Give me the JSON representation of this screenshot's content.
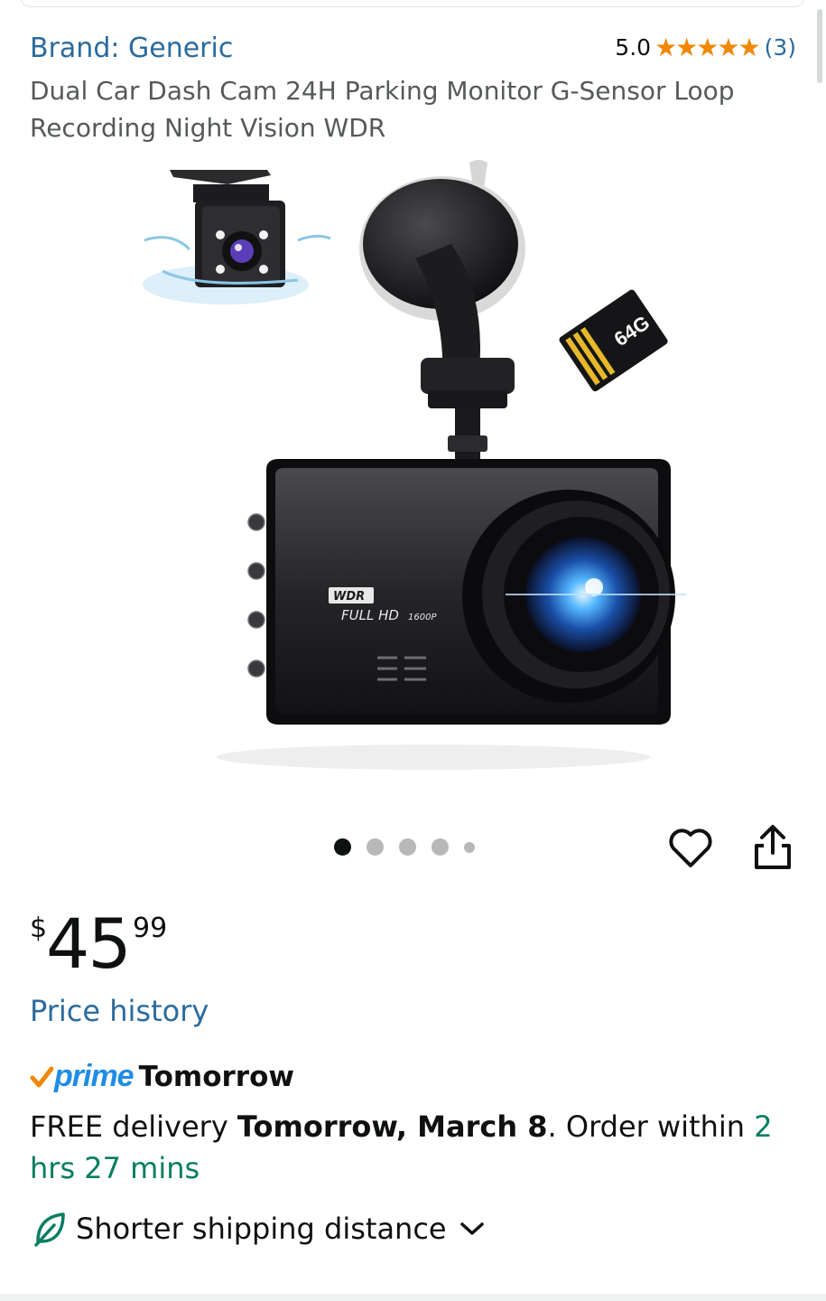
{
  "product": {
    "brand": "Brand: Generic",
    "rating_value": "5.0",
    "rating_stars": "★★★★★",
    "rating_count": "(3)",
    "title": "Dual Car Dash Cam 24H Parking Monitor G-Sensor Loop Recording Night Vision WDR"
  },
  "image": {
    "sd_card_label": "64G",
    "badge_wdr": "WDR",
    "badge_fullhd": "FULL HD",
    "badge_resolution": "1600P"
  },
  "carousel": {
    "count": 5,
    "active_index": 0
  },
  "price": {
    "symbol": "$",
    "whole": "45",
    "fraction": "99"
  },
  "links": {
    "price_history": "Price history"
  },
  "delivery": {
    "prime_label": "prime",
    "prime_tomorrow": "Tomorrow",
    "free_prefix": "FREE delivery ",
    "date": "Tomorrow, March 8",
    "order_within": ". Order within ",
    "countdown": "2 hrs 27 mins"
  },
  "shipping": {
    "label": "Shorter shipping distance"
  },
  "icons": {
    "wishlist": "heart-icon",
    "share": "share-icon",
    "prime_check": "check-icon",
    "leaf": "leaf-icon",
    "chevron": "chevron-down-icon"
  },
  "colors": {
    "link": "#2a6b9e",
    "star": "#f08804",
    "prime_blue": "#1f8ce6",
    "countdown": "#067d62",
    "check_orange": "#f08804"
  }
}
